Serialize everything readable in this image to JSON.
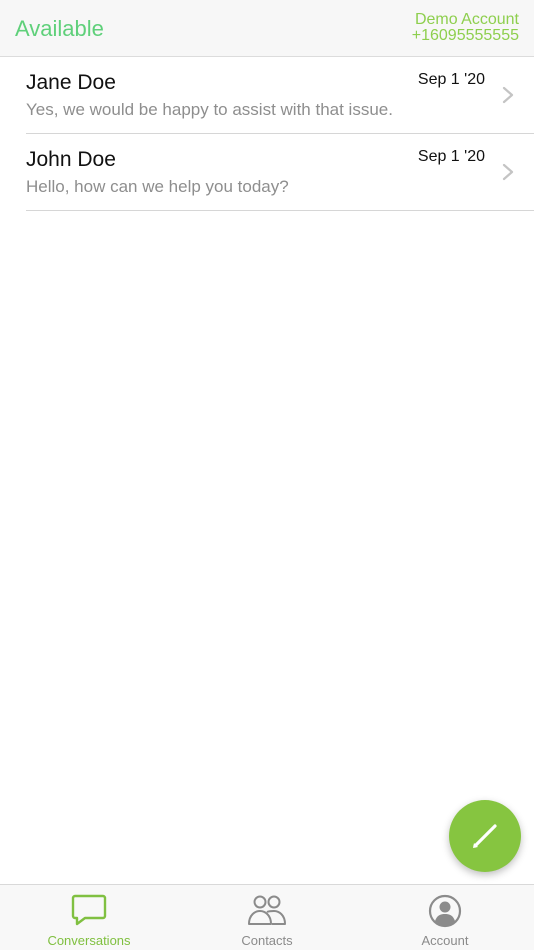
{
  "header": {
    "status": "Available",
    "account_name": "Demo Account",
    "account_number": "+16095555555"
  },
  "conversations": [
    {
      "name": "Jane Doe",
      "preview": "Yes, we would be happy to assist with that issue.",
      "date": "Sep 1 '20"
    },
    {
      "name": "John Doe",
      "preview": "Hello, how can we help you today?",
      "date": "Sep 1 '20"
    }
  ],
  "fab": {
    "icon": "pencil-icon"
  },
  "tabs": [
    {
      "label": "Conversations",
      "icon": "chat-bubble-icon",
      "active": true
    },
    {
      "label": "Contacts",
      "icon": "people-icon",
      "active": false
    },
    {
      "label": "Account",
      "icon": "user-circle-icon",
      "active": false
    }
  ],
  "colors": {
    "status_green": "#5fd07a",
    "accent_green": "#86c540",
    "inactive_gray": "#8b8b8b"
  }
}
